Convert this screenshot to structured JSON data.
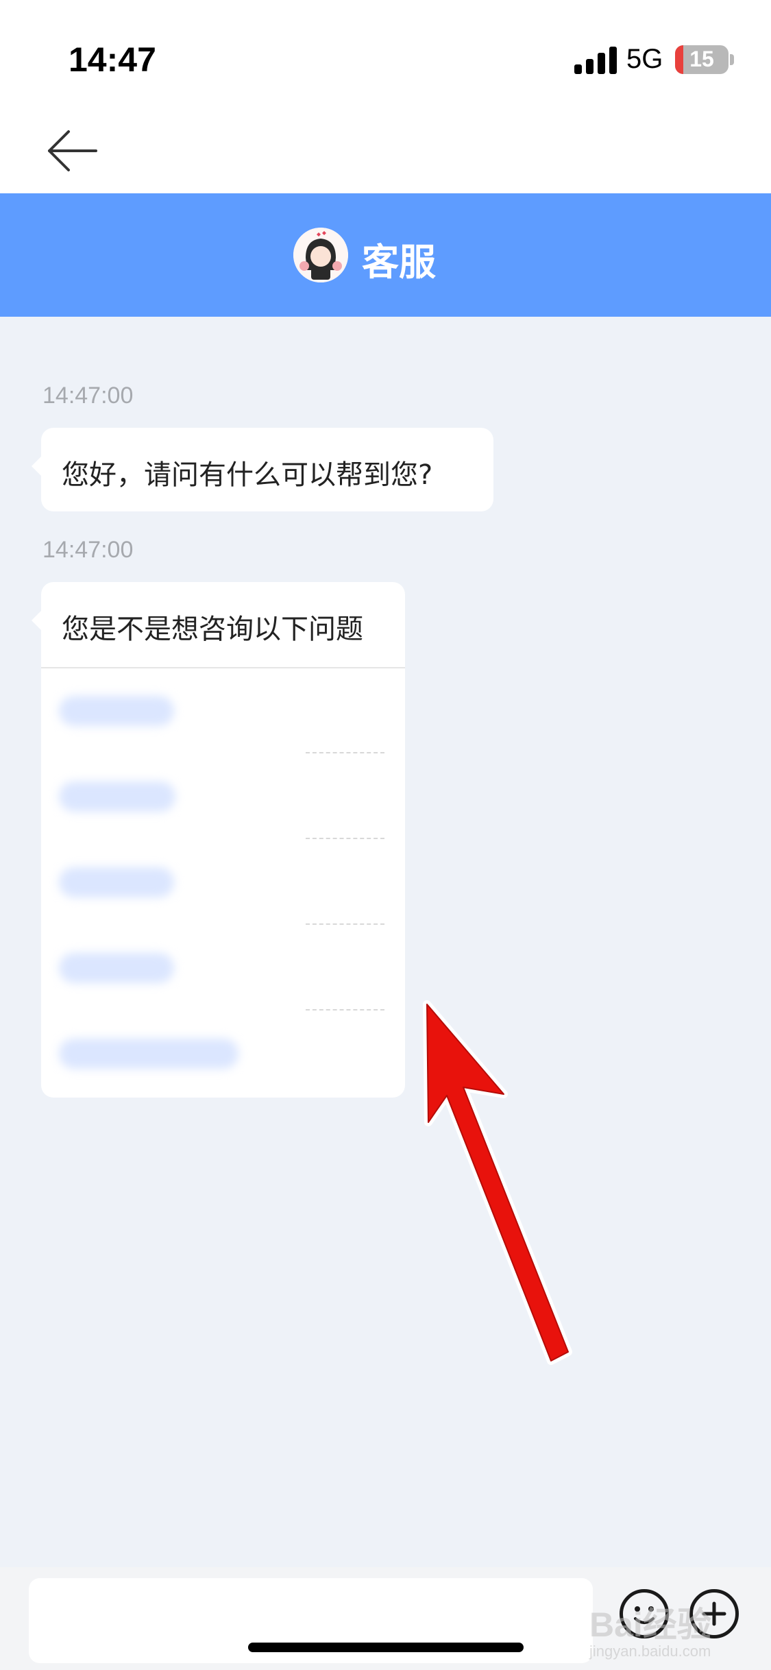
{
  "status_bar": {
    "time": "14:47",
    "network": "5G",
    "battery_level": "15"
  },
  "nav": {
    "back_icon": "arrow-left-icon"
  },
  "header": {
    "title": "客服",
    "avatar": "agent-avatar"
  },
  "messages": [
    {
      "timestamp": "14:47:00",
      "text": "您好，请问有什么可以帮到您?"
    },
    {
      "timestamp": "14:47:00",
      "text": "您是不是想咨询以下问题",
      "questions_count_blurred": 5
    }
  ],
  "input_bar": {
    "placeholder": "",
    "emoji_icon": "emoji-icon",
    "plus_icon": "plus-icon"
  },
  "watermark": {
    "brand": "Bai经验",
    "url": "jingyan.baidu.com"
  },
  "colors": {
    "header_blue": "#5e9cff",
    "background": "#eef2f8",
    "arrow_red": "#e8120c"
  }
}
